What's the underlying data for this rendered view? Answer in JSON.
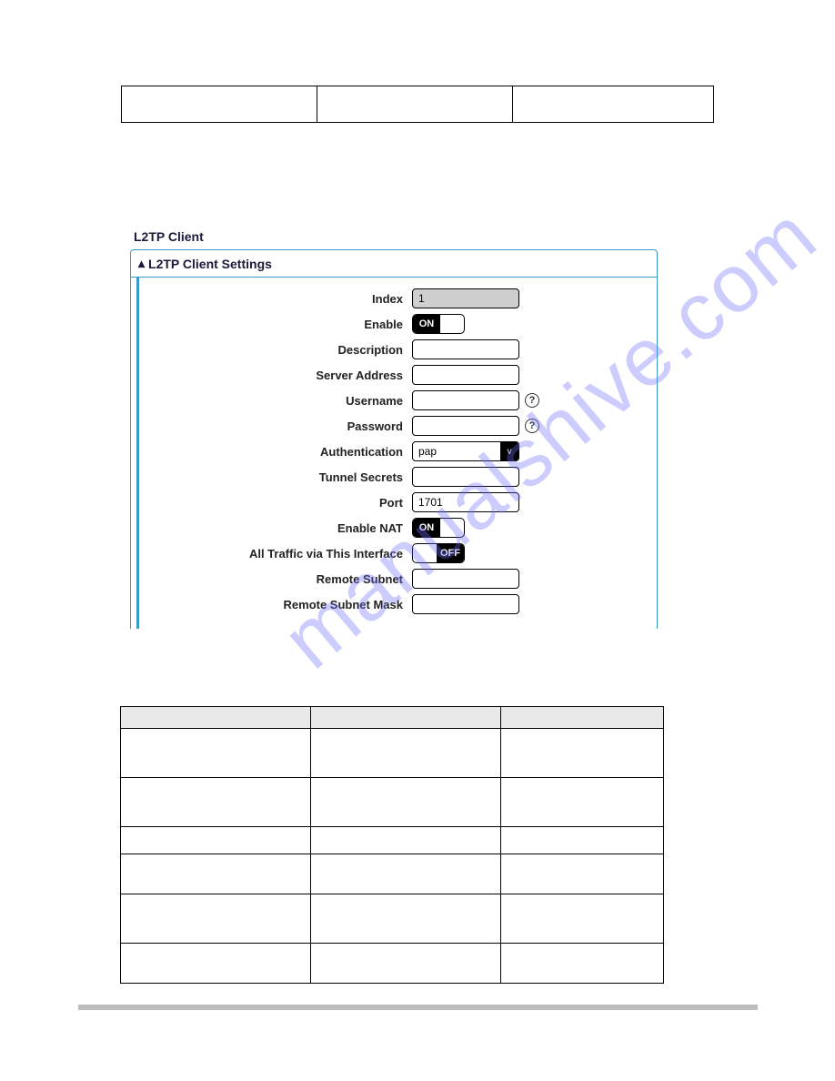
{
  "page": {
    "breadcrumb": "L2TP Client",
    "panel_heading": "L2TP Client Settings"
  },
  "form": {
    "index": {
      "label": "Index",
      "value": "1"
    },
    "enable": {
      "label": "Enable",
      "state": "ON"
    },
    "description": {
      "label": "Description",
      "value": ""
    },
    "server_address": {
      "label": "Server Address",
      "value": ""
    },
    "username": {
      "label": "Username",
      "value": ""
    },
    "password": {
      "label": "Password",
      "value": ""
    },
    "authentication": {
      "label": "Authentication",
      "value": "pap"
    },
    "tunnel_secrets": {
      "label": "Tunnel Secrets",
      "value": ""
    },
    "port": {
      "label": "Port",
      "value": "1701"
    },
    "enable_nat": {
      "label": "Enable NAT",
      "state": "ON"
    },
    "all_traffic": {
      "label": "All Traffic via This Interface",
      "state": "OFF"
    },
    "remote_subnet": {
      "label": "Remote Subnet",
      "value": ""
    },
    "remote_subnet_mask": {
      "label": "Remote Subnet Mask",
      "value": ""
    }
  },
  "watermark": "manualshive.com"
}
